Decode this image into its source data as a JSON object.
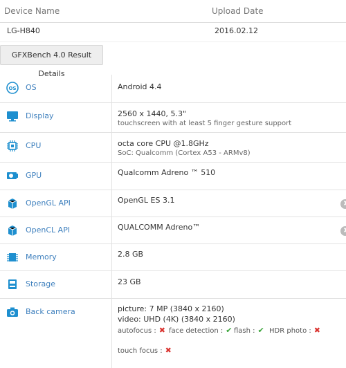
{
  "header": {
    "col_device": "Device Name",
    "col_upload": "Upload Date"
  },
  "device": {
    "name": "LG-H840",
    "upload_date": "2016.02.12"
  },
  "results_button": "GFXBench 4.0 Result Details",
  "specs": [
    {
      "label": "OS",
      "value": "Android 4.4",
      "icon": "os-icon"
    },
    {
      "label": "Display",
      "value": "2560 x 1440, 5.3\"",
      "sub": "touchscreen with at least 5 finger gesture support",
      "icon": "display-icon"
    },
    {
      "label": "CPU",
      "value": "octa core CPU @1.8GHz",
      "sub": "SoC: Qualcomm (Cortex A53 - ARMv8)",
      "icon": "cpu-icon"
    },
    {
      "label": "GPU",
      "value": "Qualcomm Adreno ™ 510",
      "icon": "gpu-icon"
    },
    {
      "label": "OpenGL API",
      "value": "OpenGL ES 3.1",
      "icon": "opengl-icon"
    },
    {
      "label": "OpenCL API",
      "value": "QUALCOMM Adreno™",
      "icon": "opencl-icon"
    },
    {
      "label": "Memory",
      "value": "2.8 GB",
      "icon": "memory-icon"
    },
    {
      "label": "Storage",
      "value": "23 GB",
      "icon": "storage-icon"
    },
    {
      "label": "Back camera",
      "value": "picture: 7 MP (3840 x 2160)",
      "sub": "video: UHD (4K) (3840 x 2160)",
      "icon": "camera-icon"
    }
  ],
  "camera_features": [
    {
      "label": "autofocus :",
      "supported": false
    },
    {
      "label": "face detection :",
      "supported": true
    },
    {
      "label": "flash :",
      "supported": true
    },
    {
      "label": "HDR photo :",
      "supported": false
    },
    {
      "label": "touch focus :",
      "supported": false
    }
  ],
  "marks": {
    "yes": "✔",
    "no": "✖"
  },
  "colors": {
    "label_blue": "#3d7fbd",
    "icon_blue": "#1e8fcf",
    "check_green": "#3ba53b",
    "cross_red": "#d9302c"
  }
}
